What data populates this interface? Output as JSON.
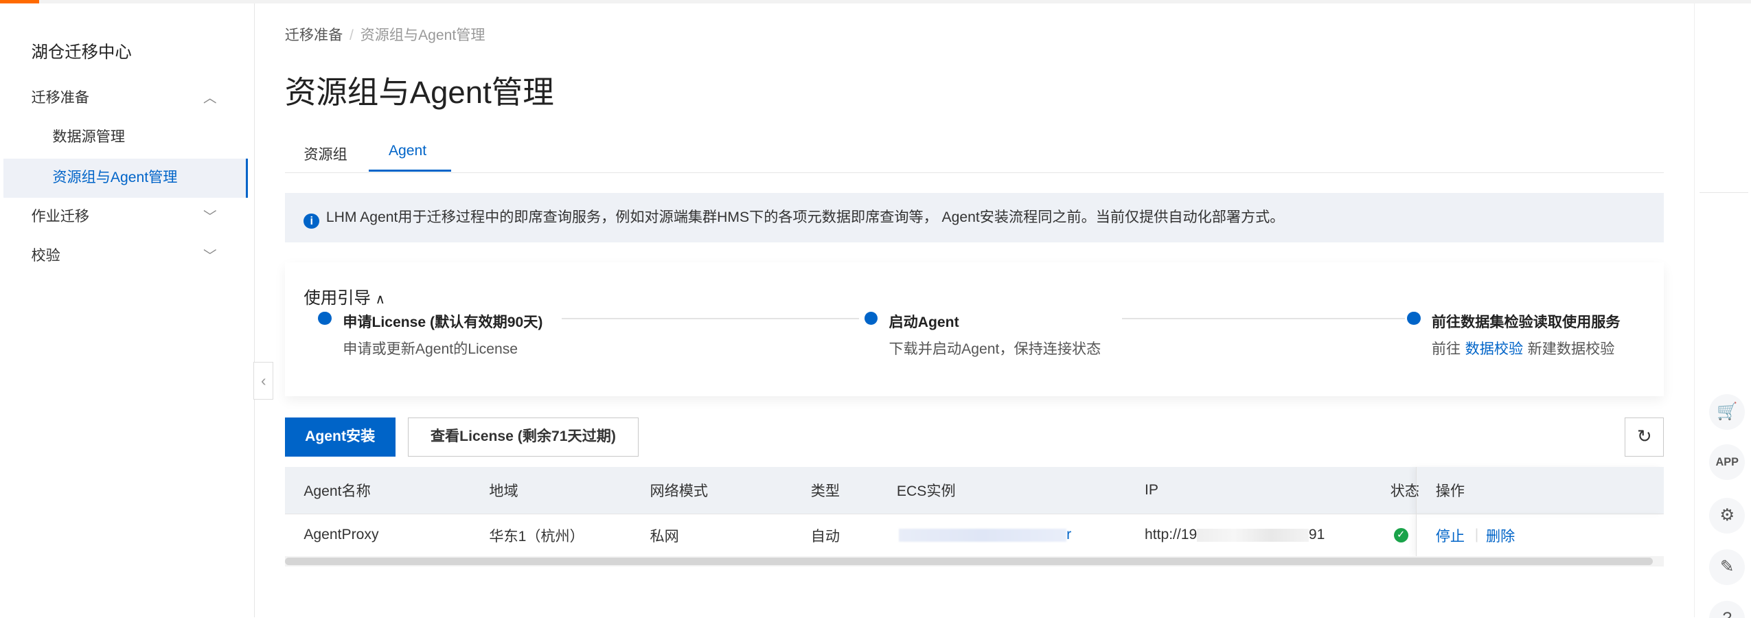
{
  "sidebar": {
    "title": "湖仓迁移中心",
    "items": [
      {
        "label": "迁移准备",
        "expanded": true
      },
      {
        "label": "数据源管理"
      },
      {
        "label": "资源组与Agent管理",
        "active": true
      },
      {
        "label": "作业迁移",
        "expanded": false
      },
      {
        "label": "校验",
        "expanded": false
      }
    ]
  },
  "breadcrumb": [
    "迁移准备",
    "资源组与Agent管理"
  ],
  "page_title": "资源组与Agent管理",
  "tabs": [
    {
      "label": "资源组"
    },
    {
      "label": "Agent",
      "active": true
    }
  ],
  "info": "LHM Agent用于迁移过程中的即席查询服务，例如对源端集群HMS下的各项元数据即席查询等， Agent安装流程同之前。当前仅提供自动化部署方式。",
  "guide": {
    "title": "使用引导",
    "steps": [
      {
        "title": "申请License (默认有效期90天)",
        "desc": "申请或更新Agent的License"
      },
      {
        "title": "启动Agent",
        "desc": "下载并启动Agent，保持连接状态"
      },
      {
        "title": "前往数据集检验读取使用服务",
        "desc_prefix": "前往",
        "link": "数据校验",
        "desc_suffix": "新建数据校验"
      }
    ]
  },
  "toolbar": {
    "install": "Agent安装",
    "license": "查看License (剩余71天过期)"
  },
  "table": {
    "headers": [
      "Agent名称",
      "地域",
      "网络模式",
      "类型",
      "ECS实例",
      "IP",
      "状态",
      "操作"
    ],
    "rows": [
      {
        "name": "AgentProxy",
        "region": "华东1（杭州）",
        "network": "私网",
        "type": "自动",
        "ecs_suffix": "r",
        "ip_prefix": "http://19",
        "ip_suffix": "91",
        "status": "running",
        "actions": [
          "停止",
          "删除"
        ]
      }
    ]
  },
  "colors": {
    "primary": "#0064c8",
    "brand": "#ff6a00",
    "success": "#1aa34a"
  }
}
